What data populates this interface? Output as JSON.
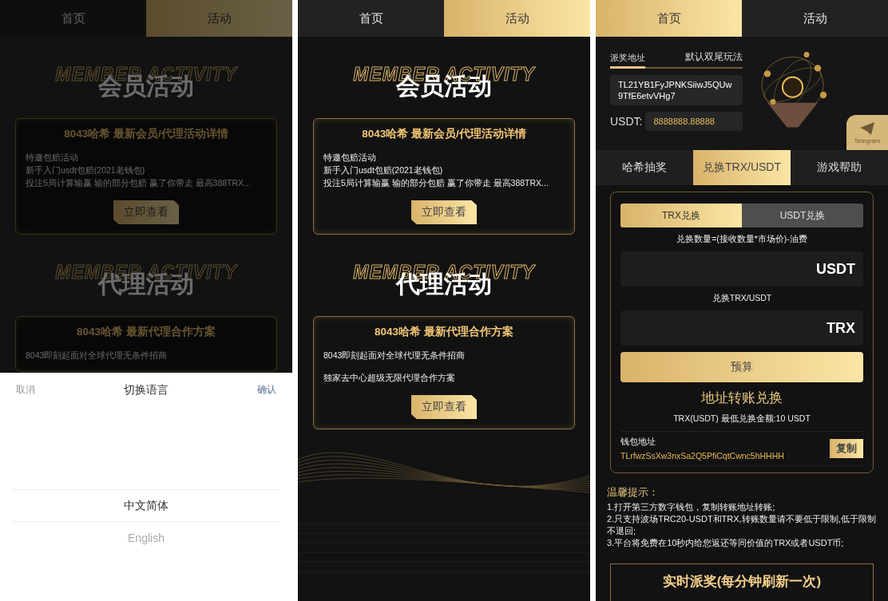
{
  "screens": [
    {
      "kind": "activity",
      "dimmed": true,
      "tabs": [
        {
          "label": "首页",
          "selected": false
        },
        {
          "label": "活动",
          "selected": true
        }
      ],
      "sections": [
        {
          "watermark": "MEMBER ACTIVITY",
          "heading": "会员活动",
          "card": {
            "title": "8043哈希 最新会员/代理活动详情",
            "lines": [
              "特邀包赔活动",
              "新手入门usdt包赔(2021老钱包)",
              "投注5局计算输赢 输的部分包赔 赢了你带走 最高388TRX..."
            ],
            "button": "立即查看"
          }
        },
        {
          "watermark": "MEMBER ACTIVITY",
          "heading": "代理活动",
          "card": {
            "title": "8043哈希 最新代理合作方案",
            "lines": [
              "8043即刻起面对全球代理无条件招商"
            ]
          }
        }
      ],
      "sheet": {
        "cancel": "取消",
        "title": "切换语言",
        "confirm": "确认",
        "options": [
          {
            "label": "中文简体",
            "selected": true
          },
          {
            "label": "English",
            "selected": false
          }
        ]
      }
    },
    {
      "kind": "activity",
      "dimmed": false,
      "tabs": [
        {
          "label": "首页",
          "selected": false
        },
        {
          "label": "活动",
          "selected": true
        }
      ],
      "sections": [
        {
          "watermark": "MEMBER ACTIVITY",
          "heading": "会员活动",
          "card": {
            "title": "8043哈希 最新会员/代理活动详情",
            "lines": [
              "特邀包赔活动",
              "新手入门usdt包赔(2021老钱包)",
              "投注5局计算输赢 输的部分包赔 赢了你带走 最高388TRX..."
            ],
            "button": "立即查看"
          }
        },
        {
          "watermark": "MEMBER ACTIVITY",
          "heading": "代理活动",
          "card": {
            "title": "8043哈希 最新代理合作方案",
            "lines": [
              "8043即刻起面对全球代理无条件招商",
              "独家去中心超级无限代理合作方案"
            ],
            "button": "立即查看"
          }
        }
      ]
    },
    {
      "kind": "home",
      "dimmed": false,
      "tabs": [
        {
          "label": "首页",
          "selected": true
        },
        {
          "label": "活动",
          "selected": false
        }
      ],
      "banner": {
        "tabs": [
          {
            "label": "派奖地址",
            "selected": true
          },
          {
            "label": "默认双尾玩法",
            "selected": false
          }
        ],
        "address": "TL21YB1FyJPNKSiiwJ5QUw9TfE6etvVHg7",
        "balance_label": "USDT:",
        "balance": "8888888.88888",
        "telegram": "Telegram"
      },
      "menu": [
        {
          "label": "哈希抽奖",
          "selected": false
        },
        {
          "label": "兑换TRX/USDT",
          "selected": true
        },
        {
          "label": "游戏帮助",
          "selected": false
        }
      ],
      "exchange": {
        "modes": [
          {
            "label": "TRX兑换",
            "selected": true
          },
          {
            "label": "USDT兑换",
            "selected": false
          }
        ],
        "formula": "兑换数量=(接收数量*市场价)-油费",
        "pay_unit": "USDT",
        "receive_label": "兑换TRX/USDT",
        "receive_unit": "TRX",
        "button": "预算",
        "transfer_heading": "地址转账兑换",
        "minimum": "TRX(USDT) 最低兑换金额:10 USDT",
        "wallet_label": "钱包地址",
        "wallet_address": "TLrfwzSsXw3nxSa2Q5PfiCqtCwnc5hHHHH",
        "copy": "复制"
      },
      "tips": {
        "title": "温馨提示：",
        "lines": [
          "1.打开第三方数字钱包，复制转账地址转账;",
          "2.只支持波场TRC20-USDT和TRX,转账数量请不要低于限制,低于限制不退回;",
          "3.平台将免费在10秒内给您返还等同价值的TRX或者USDT币;"
        ]
      },
      "live_title": "实时派奖(每分钟刷新一次)"
    }
  ]
}
